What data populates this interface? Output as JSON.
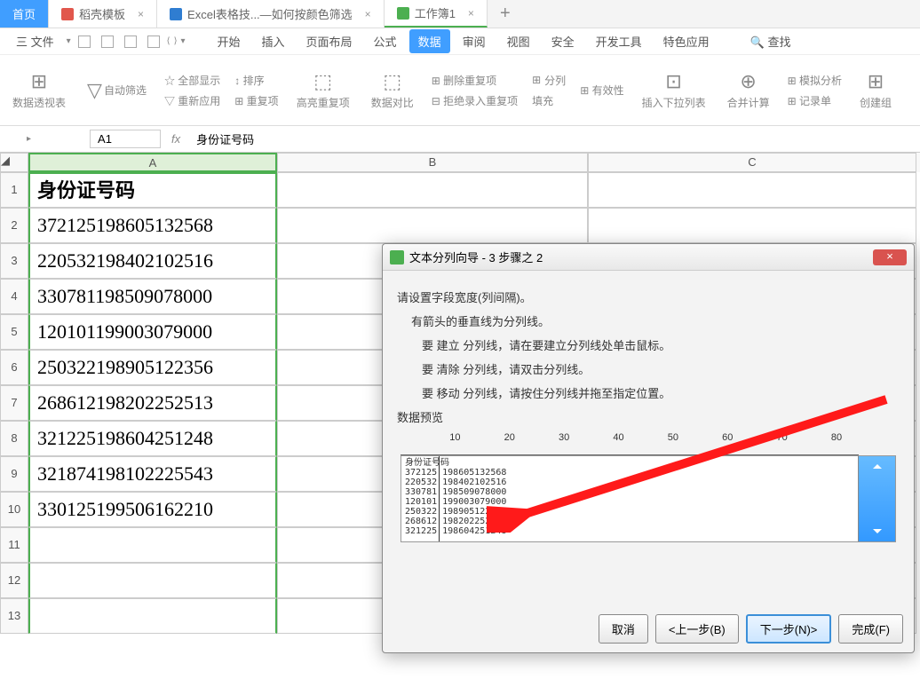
{
  "tabs": {
    "home": "首页",
    "t1_icon": "#e1574c",
    "t1": "稻壳模板",
    "t2_icon": "#2f7dd1",
    "t2": "Excel表格技...—如何按颜色筛选",
    "t3_icon": "#4caf50",
    "t3": "工作簿1"
  },
  "menu": {
    "file": "三 文件",
    "items": [
      "开始",
      "插入",
      "页面布局",
      "公式",
      "数据",
      "审阅",
      "视图",
      "安全",
      "开发工具",
      "特色应用"
    ],
    "search": "🔍 查找"
  },
  "ribbon": {
    "g1": "数据透视表",
    "g2a": "自动筛选",
    "g2b": "☆ 全部显示",
    "g2c": "▽ 重新应用",
    "g3a": "↕ 排序",
    "g3b": "⊞ 重复项",
    "g4": "高亮重复项",
    "g5": "数据对比",
    "g6a": "⊞ 删除重复项",
    "g6b": "⊟ 拒绝录入重复项",
    "g7a": "分列",
    "g7b": "填充",
    "g7c": "⊞ 有效性",
    "g8": "插入下拉列表",
    "g9": "合并计算",
    "g10a": "⊞ 模拟分析",
    "g10b": "⊞ 记录单",
    "g11": "创建组"
  },
  "fbar": {
    "name": "A1",
    "fx": "fx",
    "text": "身份证号码"
  },
  "cols": {
    "a": "A",
    "b": "B",
    "c": "C"
  },
  "data": {
    "h": "身份证号码",
    "r": [
      "372125198605132568",
      "220532198402102516",
      "330781198509078000",
      "120101199003079000",
      "250322198905122356",
      "268612198202252513",
      "321225198604251248",
      "321874198102225543",
      "330125199506162210"
    ]
  },
  "dialog": {
    "title": "文本分列向导 - 3 步骤之 2",
    "p1": "请设置字段宽度(列间隔)。",
    "p2": "有箭头的垂直线为分列线。",
    "p3": "要 建立 分列线，请在要建立分列线处单击鼠标。",
    "p4": "要 清除 分列线，请双击分列线。",
    "p5": "要 移动 分列线，请按住分列线并拖至指定位置。",
    "pvlabel": "数据预览",
    "ticks": [
      "10",
      "20",
      "30",
      "40",
      "50",
      "60",
      "70",
      "80"
    ],
    "pvtext": "身份证号码\n372125 198605132568\n220532 198402102516\n330781 198509078000\n120101 199003079000\n250322 198905122356\n268612 198202252513\n321225 198604251248",
    "btn_cancel": "取消",
    "btn_prev": "<上一步(B)",
    "btn_next": "下一步(N)>",
    "btn_finish": "完成(F)"
  }
}
